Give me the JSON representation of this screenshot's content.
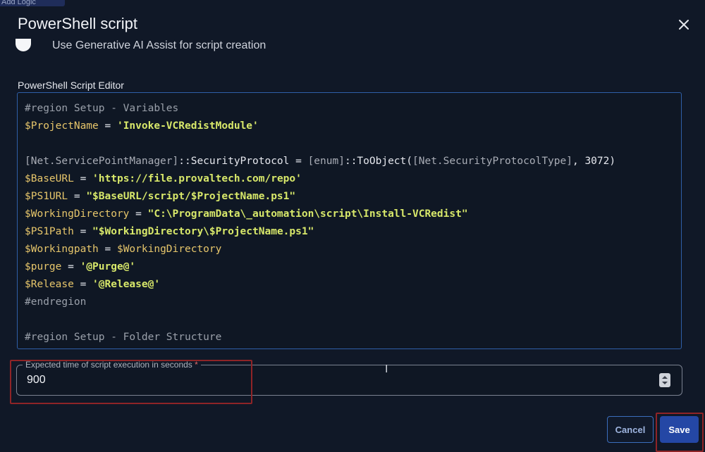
{
  "top_stub": {
    "label": "Add Logic"
  },
  "dialog": {
    "title": "PowerShell script",
    "ai_toggle_label": "Use Generative AI Assist for script creation",
    "editor_label": "PowerShell Script Editor",
    "code_lines": [
      "#region Setup - Variables",
      "$ProjectName = 'Invoke-VCRedistModule'",
      "",
      "[Net.ServicePointManager]::SecurityProtocol = [enum]::ToObject([Net.SecurityProtocolType], 3072)",
      "$BaseURL = 'https://file.provaltech.com/repo'",
      "$PS1URL = \"$BaseURL/script/$ProjectName.ps1\"",
      "$WorkingDirectory = \"C:\\ProgramData\\_automation\\script\\Install-VCRedist\"",
      "$PS1Path = \"$WorkingDirectory\\$ProjectName.ps1\"",
      "$Workingpath = $WorkingDirectory",
      "$purge = '@Purge@'",
      "$Release = '@Release@'",
      "#endregion",
      "",
      "#region Setup - Folder Structure"
    ],
    "execution_time": {
      "label": "Expected time of script execution in seconds",
      "required_marker": "*",
      "value": "900"
    },
    "buttons": {
      "cancel": "Cancel",
      "save": "Save"
    }
  },
  "colors": {
    "background": "#101827",
    "accent": "#2447a5",
    "editor_border": "#2f5fa8",
    "highlight": "#8f2427",
    "variable": "#e7c66b",
    "string": "#d8e86a",
    "comment": "#9aa0aa"
  }
}
